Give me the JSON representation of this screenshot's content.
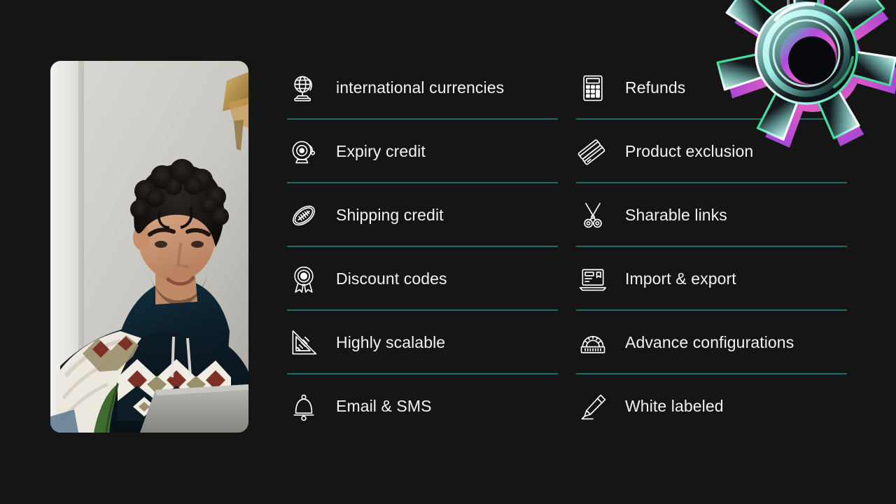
{
  "background_color": "#151515",
  "accent_color": "#1d6b6b",
  "text_color": "#f2f2f2",
  "photo": {
    "alt": "Man with curly dark hair in a patterned knit sweater working at a laptop",
    "name": "portrait-photo"
  },
  "decoration": {
    "name": "gear-3d-graphic",
    "colors": [
      "#9ff0e8",
      "#b44ae0",
      "#e85fd0",
      "#3ddc97"
    ]
  },
  "features": {
    "left_column": [
      {
        "label": "international currencies",
        "icon": "globe-stand-icon"
      },
      {
        "label": "Expiry credit",
        "icon": "alarm-bell-icon"
      },
      {
        "label": "Shipping credit",
        "icon": "football-icon"
      },
      {
        "label": "Discount codes",
        "icon": "award-ribbon-icon"
      },
      {
        "label": "Highly scalable",
        "icon": "set-square-ruler-icon"
      },
      {
        "label": "Email & SMS",
        "icon": "bell-icon"
      }
    ],
    "right_column": [
      {
        "label": "Refunds",
        "icon": "calculator-icon"
      },
      {
        "label": "Product exclusion",
        "icon": "credit-cards-icon"
      },
      {
        "label": "Sharable links",
        "icon": "scissors-icon"
      },
      {
        "label": "Import & export",
        "icon": "laptop-icon"
      },
      {
        "label": "Advance configurations",
        "icon": "protractor-icon"
      },
      {
        "label": "White labeled",
        "icon": "pen-icon"
      }
    ]
  }
}
